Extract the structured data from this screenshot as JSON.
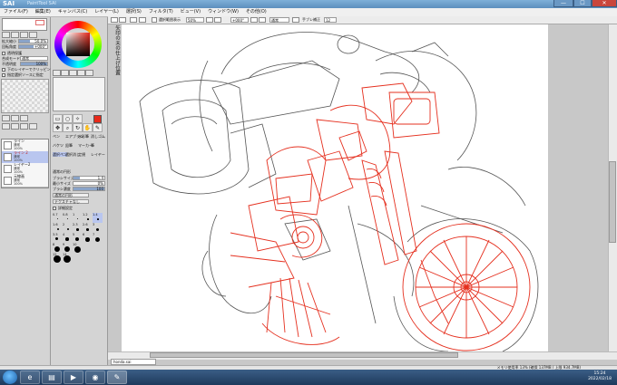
{
  "window": {
    "logo": "SAI",
    "title": "PaintTool SAI",
    "min": "—",
    "max": "☐",
    "close": "✕"
  },
  "menu": [
    "ファイル(F)",
    "編集(E)",
    "キャンバス(C)",
    "レイヤー(L)",
    "選択(S)",
    "フィルタ(T)",
    "ビュー(V)",
    "ウィンドウ(W)",
    "その他(O)"
  ],
  "toolbar": {
    "stabilizer_label": "選択範囲表示",
    "zoom_value": "50%",
    "angle_value": "+000°",
    "mode_value": "通常",
    "hand_label": "手ブレ補正",
    "hand_value": "12"
  },
  "navigator": {
    "zoom_label": "拡大縮小",
    "zoom_value": "50.0%",
    "rotate_label": "回転角度",
    "rotate_value": "+000°"
  },
  "layer_panel": {
    "protect_label": "透明保護",
    "blend_label": "合成モード",
    "blend_value": "通常",
    "opacity_label": "不透明度",
    "opacity_value": "100%",
    "clip_label": "下のレイヤーでクリッピング",
    "ref_label": "指定選択ソースに指定",
    "layers": [
      {
        "name": "ライン",
        "mode": "通常",
        "opacity": "100%"
      },
      {
        "name": "ライン 2",
        "mode": "通常",
        "opacity": "100%"
      },
      {
        "name": "レイヤー2",
        "mode": "通常",
        "opacity": "100%"
      },
      {
        "name": "元線画",
        "mode": "通常",
        "opacity": "100%"
      }
    ]
  },
  "tools": {
    "tool_names": [
      "ペン",
      "エアブラシ",
      "水彩筆",
      "消しゴム",
      "バケツ",
      "鉛筆",
      "マーカー",
      "筆",
      "選択ペン",
      "選択消し",
      "定規",
      "レイヤー"
    ],
    "brush_size_label": "ブラシサイズ",
    "brush_size_value": "1.4",
    "min_size_label": "最小サイズ",
    "min_size_value": "0%",
    "density_label": "ブラシ濃度",
    "density_value": "100",
    "normal_label": "通常の円形",
    "texture_label": "テクスチャなし",
    "detail_label": "詳細設定",
    "sizes": [
      "0.7",
      "0.8",
      "1",
      "1.2",
      "1.4",
      "1.6",
      "2",
      "2.3",
      "2.6",
      "3",
      "3.5",
      "4",
      "5",
      "6",
      "7",
      "8",
      "9",
      "10",
      "12",
      "14",
      "16",
      "20",
      "25",
      "30",
      "35",
      "40",
      "50",
      "60"
    ]
  },
  "canvas": {
    "vertical_note": "矢印の天の仕上げ位置",
    "tab_name": "honda.sai"
  },
  "status": {
    "memory": "メモリ使用率 13% (確保 137MB / 上限 934.7MB)",
    "time": "15:24",
    "date": "2022/02/18"
  },
  "colors": {
    "primary": "#e8291a",
    "line_red": "#e5301f",
    "line_dark": "#555555"
  }
}
